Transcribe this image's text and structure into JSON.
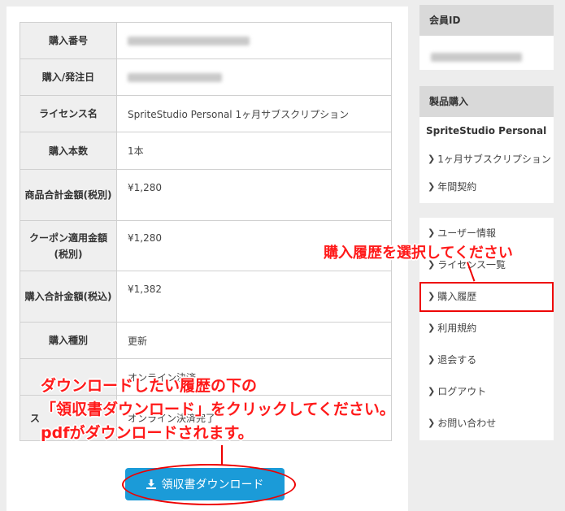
{
  "table": {
    "rows": [
      {
        "label": "購入番号",
        "value": "",
        "redacted": true
      },
      {
        "label": "購入/発注日",
        "value": "",
        "redacted": true
      },
      {
        "label": "ライセンス名",
        "value": "SpriteStudio Personal 1ヶ月サブスクリプション"
      },
      {
        "label": "購入本数",
        "value": "1本"
      },
      {
        "label": "商品合計金額(税別)",
        "value": "¥1,280"
      },
      {
        "label": "クーポン適用金額(税別)",
        "value": "¥1,280"
      },
      {
        "label": "購入合計金額(税込)",
        "value": "¥1,382"
      },
      {
        "label": "購入種別",
        "value": "更新"
      },
      {
        "label": "",
        "value": "オンライン決済",
        "partially_hidden": true
      },
      {
        "label": "ス",
        "value": "オンライン決済完了",
        "partially_hidden": true
      }
    ]
  },
  "download_button": {
    "label": "領収書ダウンロード",
    "icon": "download-icon"
  },
  "sidebar": {
    "member_box": {
      "title": "会員ID",
      "value_redacted": true
    },
    "product_box": {
      "title": "製品購入",
      "product_name": "SpriteStudio Personal",
      "items": [
        "1ヶ月サブスクリプション",
        "年間契約"
      ]
    },
    "menu": {
      "items": [
        "ユーザー情報",
        "ライセンス一覧",
        "購入履歴",
        "利用規約",
        "退会する",
        "ログアウト",
        "お問い合わせ"
      ],
      "highlighted": "購入履歴"
    }
  },
  "annotations": {
    "history_hint": "購入履歴を選択してください",
    "download_hint": "ダウンロードしたい履歴の下の\n「領収書ダウンロード」をクリックしてください。\npdfがダウンロードされます。"
  },
  "colors": {
    "accent": "#1b9bd8",
    "annotation": "#ff1a1a",
    "label_bg": "#efefef",
    "sidebar_head": "#d9d9d9"
  }
}
